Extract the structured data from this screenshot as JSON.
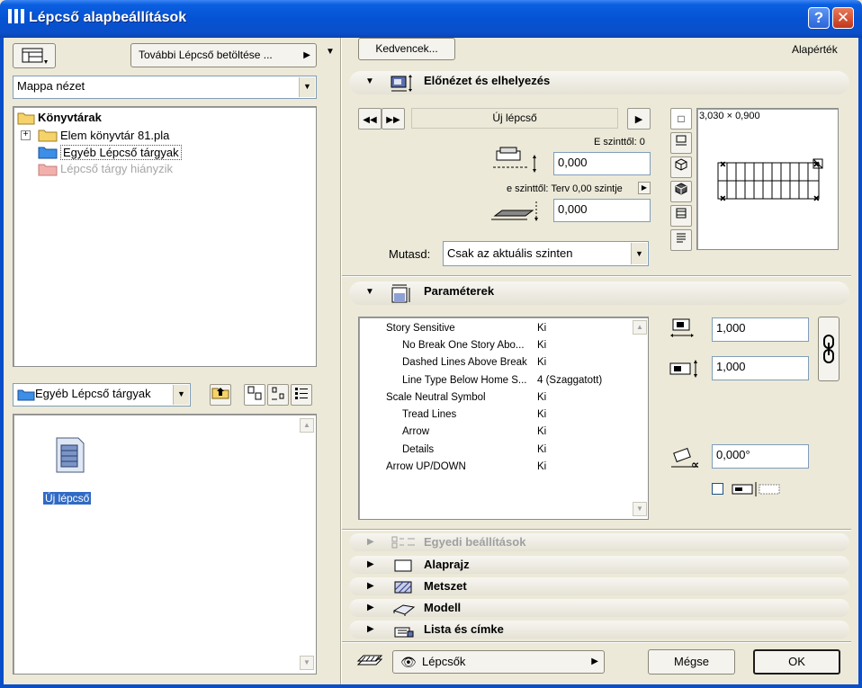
{
  "window": {
    "title": "Lépcső alapbeállítások",
    "help_glyph": "?",
    "close_glyph": "✕"
  },
  "left_panel": {
    "load_more_label": "További Lépcső betöltése ...",
    "view_mode_value": "Mappa nézet",
    "tree": {
      "root": "Könyvtárak",
      "items": [
        {
          "label": "Elem könyvtár 81.pla"
        },
        {
          "label": "Egyéb Lépcső tárgyak"
        },
        {
          "label": "Lépcső tárgy hiányzik"
        }
      ]
    },
    "folder_select_value": "Egyéb Lépcső tárgyak",
    "preview_item_label": "Új lépcső"
  },
  "right_panel": {
    "favorites_label": "Kedvencek...",
    "default_label": "Alapérték",
    "preview_section": {
      "title": "Előnézet és elhelyezés",
      "object_name": "Új lépcső",
      "from_story_label": "E szinttől: 0",
      "offset_value_1": "0,000",
      "ref_label": "e szinttől: Terv 0,00 szintje",
      "offset_value_2": "0,000",
      "dimension_readout": "3,030 × 0,900",
      "show_label": "Mutasd:",
      "show_value": "Csak az aktuális szinten"
    },
    "parameters_section": {
      "title": "Paraméterek",
      "rows": [
        {
          "name": "Story Sensitive",
          "value": "Ki",
          "indent": 0
        },
        {
          "name": "No Break One Story Abo...",
          "value": "Ki",
          "indent": 1
        },
        {
          "name": "Dashed Lines Above Break",
          "value": "Ki",
          "indent": 1
        },
        {
          "name": "Line Type Below Home S...",
          "value": "4 (Szaggatott)",
          "indent": 1
        },
        {
          "name": "Scale Neutral Symbol",
          "value": "Ki",
          "indent": 0
        },
        {
          "name": "Tread Lines",
          "value": "Ki",
          "indent": 1
        },
        {
          "name": "Arrow",
          "value": "Ki",
          "indent": 1
        },
        {
          "name": "Details",
          "value": "Ki",
          "indent": 1
        },
        {
          "name": "Arrow UP/DOWN",
          "value": "Ki",
          "indent": 0
        }
      ],
      "width_value": "1,000",
      "length_value": "1,000",
      "angle_value": "0,000°"
    },
    "collapsed_sections": [
      {
        "title": "Egyedi beállítások",
        "disabled": true
      },
      {
        "title": "Alaprajz",
        "disabled": false
      },
      {
        "title": "Metszet",
        "disabled": false
      },
      {
        "title": "Modell",
        "disabled": false
      },
      {
        "title": "Lista és címke",
        "disabled": false
      }
    ]
  },
  "footer": {
    "layer_value": "Lépcsők",
    "cancel_label": "Mégse",
    "ok_label": "OK"
  }
}
